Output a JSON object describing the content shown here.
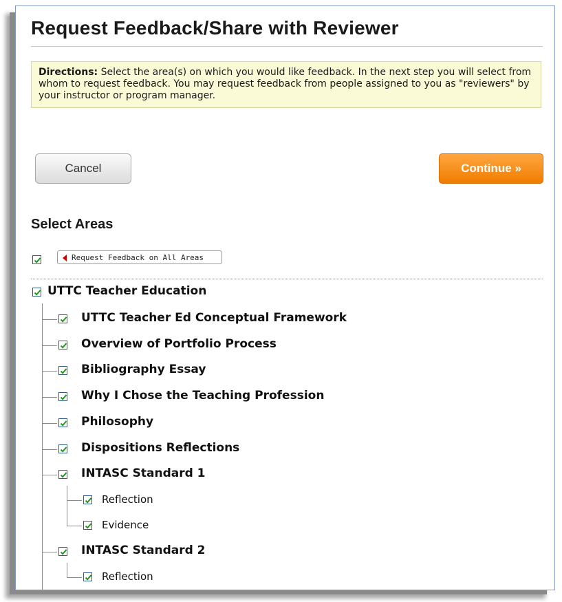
{
  "page": {
    "title": "Request Feedback/Share with Reviewer",
    "directions_label": "Directions:",
    "directions_text": " Select the area(s) on which you would like feedback. In the next step you will select from whom to request feedback. You may request feedback from people assigned to you as \"reviewers\" by your instructor or program manager.",
    "cancel_label": "Cancel",
    "continue_label": "Continue »",
    "select_areas_heading": "Select Areas",
    "request_all_label": "Request Feedback on All Areas"
  },
  "tree": {
    "root": {
      "label": "UTTC Teacher Education",
      "checked": true
    },
    "items": [
      {
        "label": "UTTC Teacher Ed Conceptual Framework",
        "checked": true
      },
      {
        "label": "Overview of Portfolio Process",
        "checked": true
      },
      {
        "label": "Bibliography Essay",
        "checked": true
      },
      {
        "label": "Why I Chose the Teaching Profession",
        "checked": true
      },
      {
        "label": "Philosophy",
        "checked": true
      },
      {
        "label": "Dispositions Reflections",
        "checked": true
      },
      {
        "label": "INTASC Standard 1",
        "checked": true,
        "children": [
          {
            "label": "Reflection",
            "checked": true
          },
          {
            "label": "Evidence",
            "checked": true
          }
        ]
      },
      {
        "label": "INTASC Standard 2",
        "checked": true,
        "children": [
          {
            "label": "Reflection",
            "checked": true
          }
        ]
      }
    ]
  },
  "colors": {
    "accent_orange": "#f07d00",
    "check_green": "#1f9a1f",
    "directions_bg": "#fafad6",
    "warning_arrow_red": "#cc0000"
  }
}
